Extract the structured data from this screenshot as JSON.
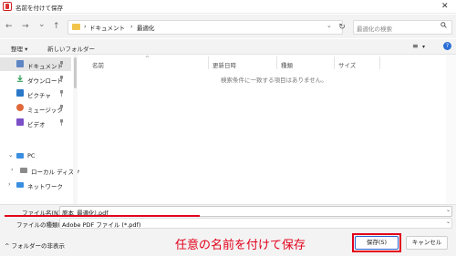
{
  "window": {
    "title": "名前を付けて保存",
    "close_glyph": "✕"
  },
  "nav": {
    "back": "←",
    "forward": "→",
    "dropdown": "⌄",
    "up": "↑",
    "breadcrumb": [
      "ドキュメント",
      "最適化"
    ],
    "separator": "›",
    "refresh": "↻",
    "search_placeholder": "最適化の検索"
  },
  "toolbar": {
    "organize": "整理 ▾",
    "new_folder": "新しいフォルダー",
    "view_icon": "≡",
    "view_caret": "▾",
    "help": "?"
  },
  "sidebar": {
    "items": [
      {
        "label": "ドキュメント",
        "icon": "document-icon",
        "color": "#5f86c4"
      },
      {
        "label": "ダウンロード",
        "icon": "download-icon",
        "color": "#2f9c57"
      },
      {
        "label": "ピクチャ",
        "icon": "picture-icon",
        "color": "#2b78c9"
      },
      {
        "label": "ミュージック",
        "icon": "music-icon",
        "color": "#e0683a"
      },
      {
        "label": "ビデオ",
        "icon": "video-icon",
        "color": "#7b4fc7"
      },
      {
        "label": "PC",
        "icon": "pc-icon",
        "color": "#3a8ee0"
      },
      {
        "label": "ローカル ディスク",
        "icon": "disk-icon",
        "color": "#6a6a6a"
      },
      {
        "label": "ネットワーク",
        "icon": "network-icon",
        "color": "#3a8ee0"
      }
    ],
    "pin": "📌",
    "expand_down": "⌄",
    "expand_right": "›"
  },
  "columns": [
    "名前",
    "更新日時",
    "種類",
    "サイズ"
  ],
  "empty_message": "検索条件に一致する項目はありません。",
  "file_name": {
    "label": "ファイル名(N):",
    "value": "原本_最適化|.pdf"
  },
  "file_type": {
    "label": "ファイルの種類(T):",
    "value": "Adobe PDF ファイル (*.pdf)"
  },
  "footer": {
    "hide_folders": "フォルダーの非表示",
    "annotation": "任意の名前を付けて保存",
    "save": "保存(S)",
    "cancel": "キャンセル"
  },
  "colors": {
    "accent_red": "#e2001a",
    "primary_blue": "#2b63d1"
  }
}
